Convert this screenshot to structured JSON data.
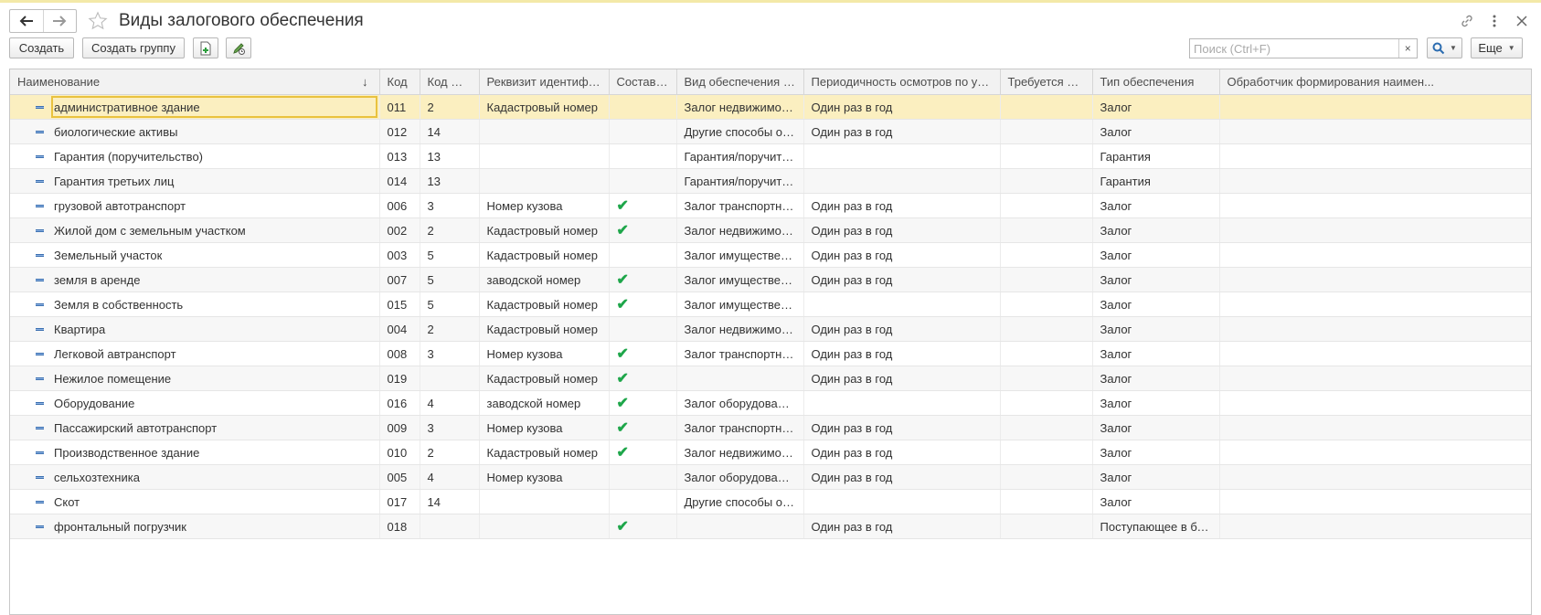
{
  "window": {
    "title": "Виды залогового обеспечения"
  },
  "toolbar": {
    "create_label": "Создать",
    "create_group_label": "Создать группу",
    "search_placeholder": "Поиск (Ctrl+F)",
    "clear_label": "×",
    "more_label": "Еще"
  },
  "icons": {
    "back": "arrow-left-icon",
    "forward": "arrow-right-icon",
    "favorite": "star-icon",
    "link": "link-icon",
    "menu": "more-vertical-icon",
    "add_doc": "add-document-icon",
    "edit": "edit-pencil-icon",
    "search": "search-icon"
  },
  "colors": {
    "selected_row": "#fbefc0",
    "selected_border": "#e9c23f",
    "check": "#1ea64a",
    "header_bg": "#f2f2f2"
  },
  "table": {
    "columns": [
      "Наименование",
      "Код",
      "Код ПКБ",
      "Реквизит идентифик...",
      "Составное",
      "Вид обеспечения НБ",
      "Периодичность осмотров по умо...",
      "Требуется НОК",
      "Тип обеспечения",
      "Обработчик формирования наимен..."
    ],
    "sort_indicator": "↓",
    "rows": [
      {
        "name": "административное здание",
        "code": "011",
        "pkb": "2",
        "req": "Кадастровый номер",
        "composite": "",
        "nb": "Залог недвижимост...",
        "period": "Один раз в год",
        "nok": "",
        "type": "Залог",
        "handler": ""
      },
      {
        "name": "биологические активы",
        "code": "012",
        "pkb": "14",
        "req": "",
        "composite": "",
        "nb": "Другие способы об...",
        "period": "Один раз в год",
        "nok": "",
        "type": "Залог",
        "handler": ""
      },
      {
        "name": "Гарантия (поручительство)",
        "code": "013",
        "pkb": "13",
        "req": "",
        "composite": "",
        "nb": "Гарантия/поручител...",
        "period": "",
        "nok": "",
        "type": "Гарантия",
        "handler": ""
      },
      {
        "name": "Гарантия третьих лиц",
        "code": "014",
        "pkb": "13",
        "req": "",
        "composite": "",
        "nb": "Гарантия/поручител...",
        "period": "",
        "nok": "",
        "type": "Гарантия",
        "handler": ""
      },
      {
        "name": "грузовой автотранспорт",
        "code": "006",
        "pkb": "3",
        "req": "Номер кузова",
        "composite": "✔",
        "nb": "Залог транспортны...",
        "period": "Один раз в год",
        "nok": "",
        "type": "Залог",
        "handler": ""
      },
      {
        "name": "Жилой дом с земельным участком",
        "code": "002",
        "pkb": "2",
        "req": "Кадастровый номер",
        "composite": "✔",
        "nb": "Залог недвижимост...",
        "period": "Один раз в год",
        "nok": "",
        "type": "Залог",
        "handler": ""
      },
      {
        "name": "Земельный участок",
        "code": "003",
        "pkb": "5",
        "req": "Кадастровый номер",
        "composite": "",
        "nb": "Залог имуществен...",
        "period": "Один раз в год",
        "nok": "",
        "type": "Залог",
        "handler": ""
      },
      {
        "name": "земля в аренде",
        "code": "007",
        "pkb": "5",
        "req": "заводской номер",
        "composite": "✔",
        "nb": "Залог имуществен...",
        "period": "Один раз в год",
        "nok": "",
        "type": "Залог",
        "handler": ""
      },
      {
        "name": "Земля в собственность",
        "code": "015",
        "pkb": "5",
        "req": "Кадастровый номер",
        "composite": "✔",
        "nb": "Залог имуществен...",
        "period": "",
        "nok": "",
        "type": "Залог",
        "handler": ""
      },
      {
        "name": "Квартира",
        "code": "004",
        "pkb": "2",
        "req": "Кадастровый номер",
        "composite": "",
        "nb": "Залог недвижимост...",
        "period": "Один раз в год",
        "nok": "",
        "type": "Залог",
        "handler": ""
      },
      {
        "name": "Легковой автранспорт",
        "code": "008",
        "pkb": "3",
        "req": "Номер кузова",
        "composite": "✔",
        "nb": "Залог транспортны...",
        "period": "Один раз в год",
        "nok": "",
        "type": "Залог",
        "handler": ""
      },
      {
        "name": "Нежилое помещение",
        "code": "019",
        "pkb": "",
        "req": "Кадастровый номер",
        "composite": "✔",
        "nb": "",
        "period": "Один раз в год",
        "nok": "",
        "type": "Залог",
        "handler": ""
      },
      {
        "name": "Оборудование",
        "code": "016",
        "pkb": "4",
        "req": "заводской номер",
        "composite": "✔",
        "nb": "Залог оборудовани...",
        "period": "",
        "nok": "",
        "type": "Залог",
        "handler": ""
      },
      {
        "name": "Пассажирский автотранспорт",
        "code": "009",
        "pkb": "3",
        "req": "Номер кузова",
        "composite": "✔",
        "nb": "Залог транспортны...",
        "period": "Один раз в год",
        "nok": "",
        "type": "Залог",
        "handler": ""
      },
      {
        "name": "Производственное здание",
        "code": "010",
        "pkb": "2",
        "req": "Кадастровый номер",
        "composite": "✔",
        "nb": "Залог недвижимост...",
        "period": "Один раз в год",
        "nok": "",
        "type": "Залог",
        "handler": ""
      },
      {
        "name": "сельхозтехника",
        "code": "005",
        "pkb": "4",
        "req": "Номер кузова",
        "composite": "",
        "nb": "Залог оборудовани...",
        "period": "Один раз в год",
        "nok": "",
        "type": "Залог",
        "handler": ""
      },
      {
        "name": "Скот",
        "code": "017",
        "pkb": "14",
        "req": "",
        "composite": "",
        "nb": "Другие способы об...",
        "period": "",
        "nok": "",
        "type": "Залог",
        "handler": ""
      },
      {
        "name": "фронтальный погрузчик",
        "code": "018",
        "pkb": "",
        "req": "",
        "composite": "✔",
        "nb": "",
        "period": "Один раз в год",
        "nok": "",
        "type": "Поступающее в бу...",
        "handler": ""
      }
    ]
  }
}
